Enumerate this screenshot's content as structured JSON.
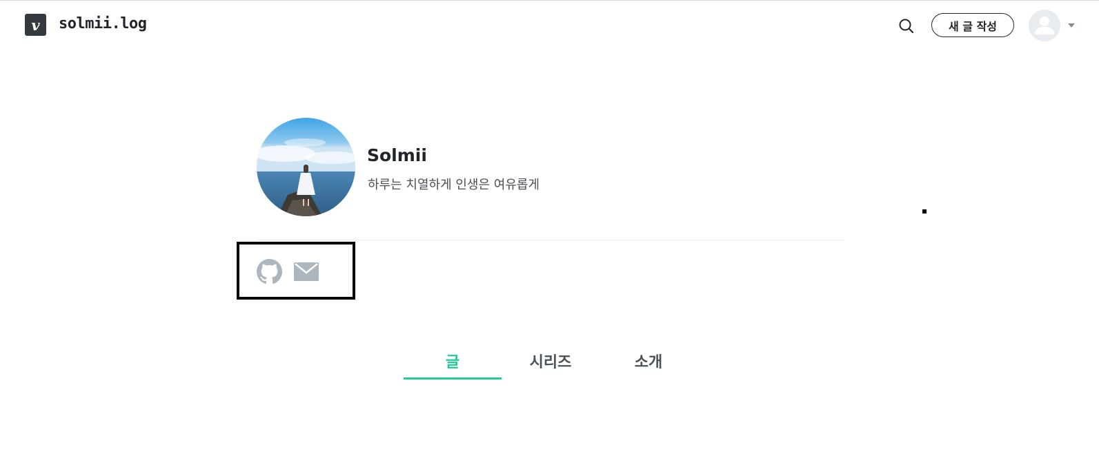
{
  "header": {
    "logo_letter": "v",
    "blog_name": "solmii.log",
    "write_button": "새 글 작성",
    "icons": [
      "velog-logo-icon",
      "search-icon",
      "user-avatar-icon",
      "caret-down-icon"
    ]
  },
  "profile": {
    "name": "Solmii",
    "bio": "하루는 치열하게 인생은 여유롭게",
    "social_icons": [
      "github-icon",
      "mail-icon"
    ]
  },
  "tabs": [
    {
      "label": "글",
      "active": true
    },
    {
      "label": "시리즈",
      "active": false
    },
    {
      "label": "소개",
      "active": false
    }
  ],
  "colors": {
    "accent": "#20c997",
    "text": "#212529",
    "muted_icon": "#adb5bd",
    "logo_bg": "#343a40"
  }
}
